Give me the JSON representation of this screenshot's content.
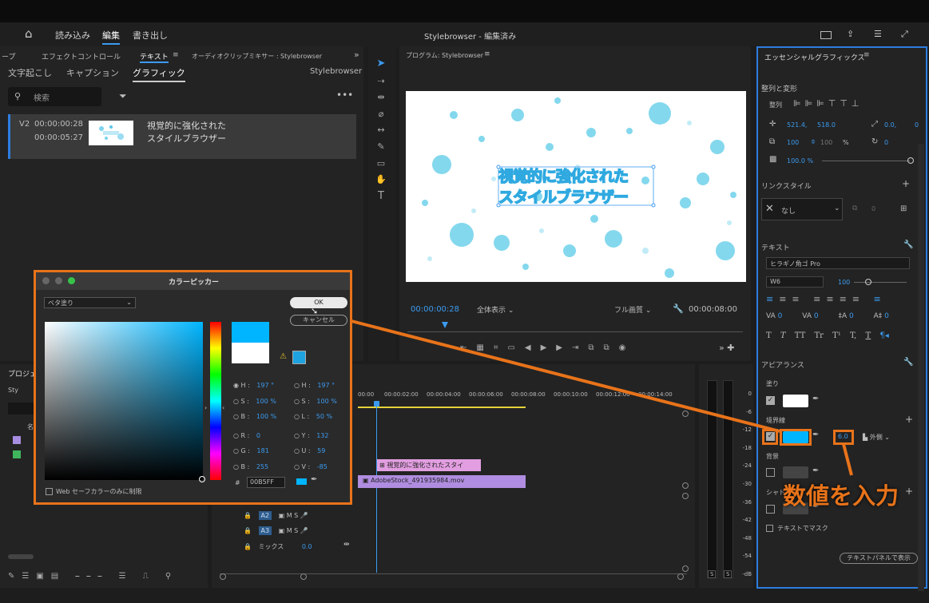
{
  "menu": {
    "home": "⌂",
    "import": "読み込み",
    "edit": "編集",
    "export": "書き出し",
    "title": "Stylebrowser - 編集済み"
  },
  "leftpanel": {
    "tabs": [
      "ープ",
      "エフェクトコントロール",
      "テキスト",
      "オーディオクリップミキサー : Stylebrowser"
    ],
    "subtabs": [
      "文字起こし",
      "キャプション",
      "グラフィック"
    ],
    "sequence": "Stylebrowser",
    "search_placeholder": "検索",
    "clip": {
      "track": "V2",
      "start": "00:00:00:28",
      "dur": "00:00:05:27",
      "line1": "視覚的に強化された",
      "line2": "スタイルブラウザー"
    }
  },
  "program": {
    "title": "プログラム: Stylebrowser",
    "timecode": "00:00:00:28",
    "zoom": "全体表示",
    "quality": "フル画質",
    "duration": "00:00:08:00",
    "overlay1": "視覚的に強化された",
    "overlay2": "スタイルブラウザー"
  },
  "picker": {
    "title": "カラーピッカー",
    "mode": "ベタ塗り",
    "ok": "OK",
    "cancel": "キャンセル",
    "hsb": [
      {
        "k": "H :",
        "v": "197 °"
      },
      {
        "k": "S :",
        "v": "100 %"
      },
      {
        "k": "B :",
        "v": "100 %"
      }
    ],
    "hsl": [
      {
        "k": "H :",
        "v": "197 °"
      },
      {
        "k": "S :",
        "v": "100 %"
      },
      {
        "k": "L :",
        "v": "50 %"
      }
    ],
    "rgb": [
      {
        "k": "R :",
        "v": "0"
      },
      {
        "k": "G :",
        "v": "181"
      },
      {
        "k": "B :",
        "v": "255"
      }
    ],
    "yuv": [
      {
        "k": "Y :",
        "v": "132"
      },
      {
        "k": "U :",
        "v": "59"
      },
      {
        "k": "V :",
        "v": "-85"
      }
    ],
    "hex_label": "#",
    "hex": "00B5FF",
    "websafe": "Web セーフカラーのみに制限",
    "color": "#00b5ff"
  },
  "timeline": {
    "ticks": [
      "00:00",
      "00:00:02:00",
      "00:00:04:00",
      "00:00:06:00",
      "00:00:08:00",
      "00:00:10:00",
      "00:00:12:00",
      "00:00:14:00"
    ],
    "clip_text": "視覚的に強化されたスタイ",
    "clip_video": "AdobeStock_491935984.mov",
    "tracks": [
      "A2",
      "A3"
    ],
    "mix_label": "ミックス",
    "mix_value": "0.0"
  },
  "project": {
    "label": "プロジェ",
    "sub": "Sty",
    "name_col": "名"
  },
  "meter": {
    "labels": [
      "0",
      "-6",
      "-12",
      "-18",
      "-24",
      "-30",
      "-36",
      "-42",
      "-48",
      "-54",
      "-dB"
    ],
    "s": "S"
  },
  "essential": {
    "title": "エッセンシャルグラフィックス",
    "align_section": "整列と変形",
    "align_label": "整列",
    "pos_x": "521.4,",
    "pos_y": "518.0",
    "anchor_x": "0.0,",
    "anchor_y": "0",
    "scale": "100",
    "scale2": "100",
    "scale_unit": "%",
    "rotation": "0",
    "opacity": "100.0 %",
    "link_section": "リンクスタイル",
    "link_value": "なし",
    "link_count": "0",
    "text_section": "テキスト",
    "font": "ヒラギノ角ゴ Pro",
    "weight": "W6",
    "size": "100",
    "tracking": [
      "0",
      "0",
      "0",
      "0"
    ],
    "type_buttons": [
      "T",
      "T",
      "TT",
      "Tr",
      "T¹",
      "T,",
      "T"
    ],
    "appearance": "アピアランス",
    "fill": "塗り",
    "stroke": "境界線",
    "stroke_width": "6.0",
    "stroke_side": "外側",
    "background": "背景",
    "shadow": "シャド",
    "mask": "テキストでマスク",
    "show_panel": "テキストパネルで表示",
    "annotation": "数値を入力"
  },
  "colors": {
    "accent": "#e8731a",
    "blue": "#3b9bf0",
    "stroke": "#00b5ff"
  }
}
